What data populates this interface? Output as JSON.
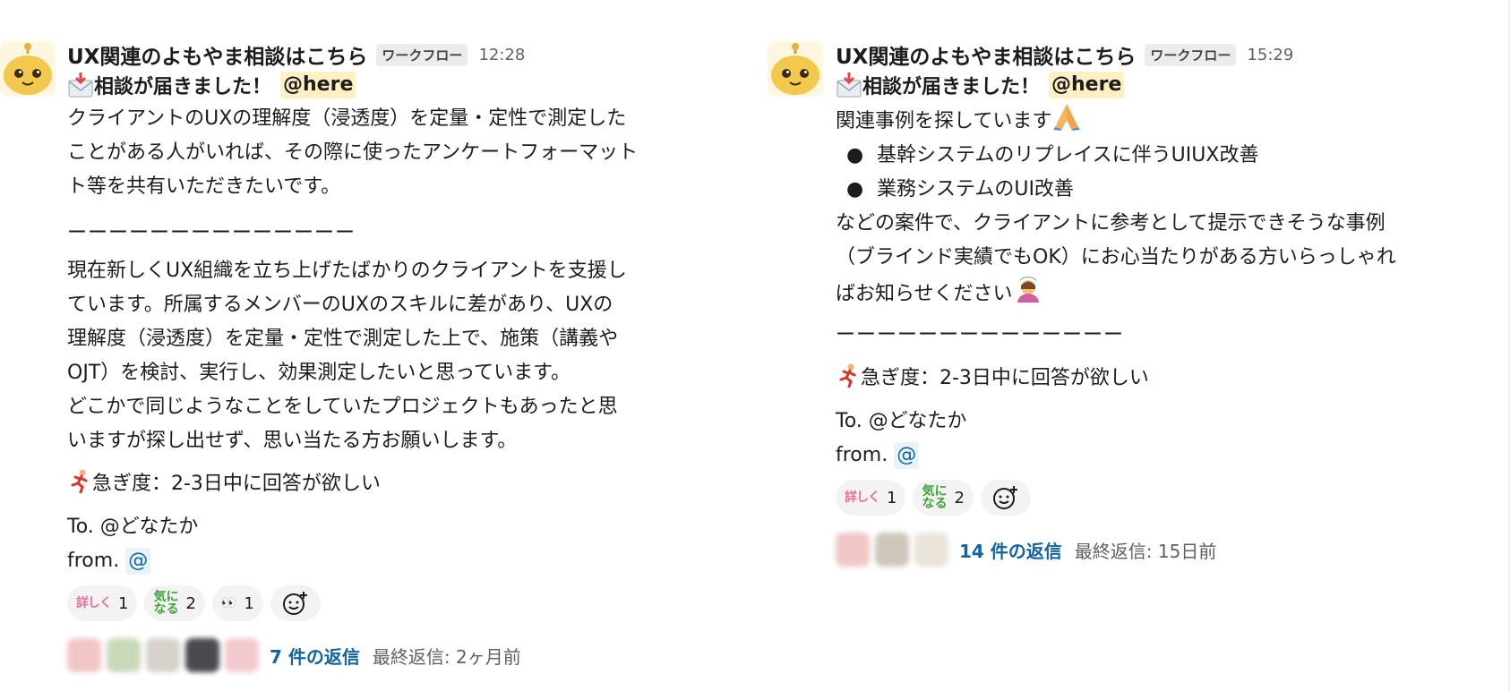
{
  "messages": [
    {
      "app_name": "UX関連のよもやま相談はこちら",
      "badge": "ワークフロー",
      "time": "12:28",
      "title": "相談が届きました！",
      "mention": "@here",
      "body_lines_1": [
        "クライアントのUXの理解度（浸透度）を定量・定性で測定した",
        "ことがある人がいれば、その際に使ったアンケートフォーマット",
        "ト等を共有いただきたいです。"
      ],
      "dash": "ーーーーーーーーーーーーーー",
      "body_lines_2": [
        "現在新しくUX組織を立ち上げたばかりのクライアントを支援し",
        "ています。所属するメンバーのUXのスキルに差があり、UXの",
        "理解度（浸透度）を定量・定性で測定した上で、施策（講義や",
        "OJT）を検討、実行し、効果測定したいと思っています。",
        "どこかで同じようなことをしていたプロジェクトもあったと思",
        "いますが探し出せず、思い当たる方お願いします。"
      ],
      "urgency": "急ぎ度：2-3日中に回答が欲しい",
      "to": "To. @どなたか",
      "from_label": "from.",
      "from_mention": "@",
      "reactions": [
        {
          "emoji_text": "詳しく",
          "count": "1"
        },
        {
          "emoji_text": "気になる",
          "count": "2"
        },
        {
          "emoji_text": "👀",
          "count": "1"
        }
      ],
      "reply_count": "7 件の返信",
      "last_reply": "最終返信: 2ヶ月前"
    },
    {
      "app_name": "UX関連のよもやま相談はこちら",
      "badge": "ワークフロー",
      "time": "15:29",
      "title": "相談が届きました！",
      "mention": "@here",
      "intro": "関連事例を探しています",
      "bullets": [
        "基幹システムのリプレイスに伴うUIUX改善",
        "業務システムのUI改善"
      ],
      "body_lines": [
        "などの案件で、クライアントに参考として提示できそうな事例",
        "（ブラインド実績でもOK）にお心当たりがある方いらっしゃれ",
        "ばお知らせください"
      ],
      "dash": "ーーーーーーーーーーーーーー",
      "urgency": "急ぎ度：2-3日中に回答が欲しい",
      "to": "To. @どなたか",
      "from_label": "from.",
      "from_mention": "@",
      "reactions": [
        {
          "emoji_text": "詳しく",
          "count": "1"
        },
        {
          "emoji_text": "気になる",
          "count": "2"
        }
      ],
      "reply_count": "14 件の返信",
      "last_reply": "最終返信: 15日前"
    }
  ],
  "colors": {
    "mention_bg": "#fdf0c2",
    "link_blue": "#1264a3",
    "reaction_bg": "#f3f3f3",
    "avatar_yellow": "#f2c94c"
  },
  "icons": {
    "avatar": "robot-bot-icon",
    "envelope": "incoming-envelope-icon",
    "runner": "runner-icon",
    "pray": "folded-hands-icon",
    "bow": "person-bowing-icon",
    "add_reaction": "add-reaction-icon"
  }
}
